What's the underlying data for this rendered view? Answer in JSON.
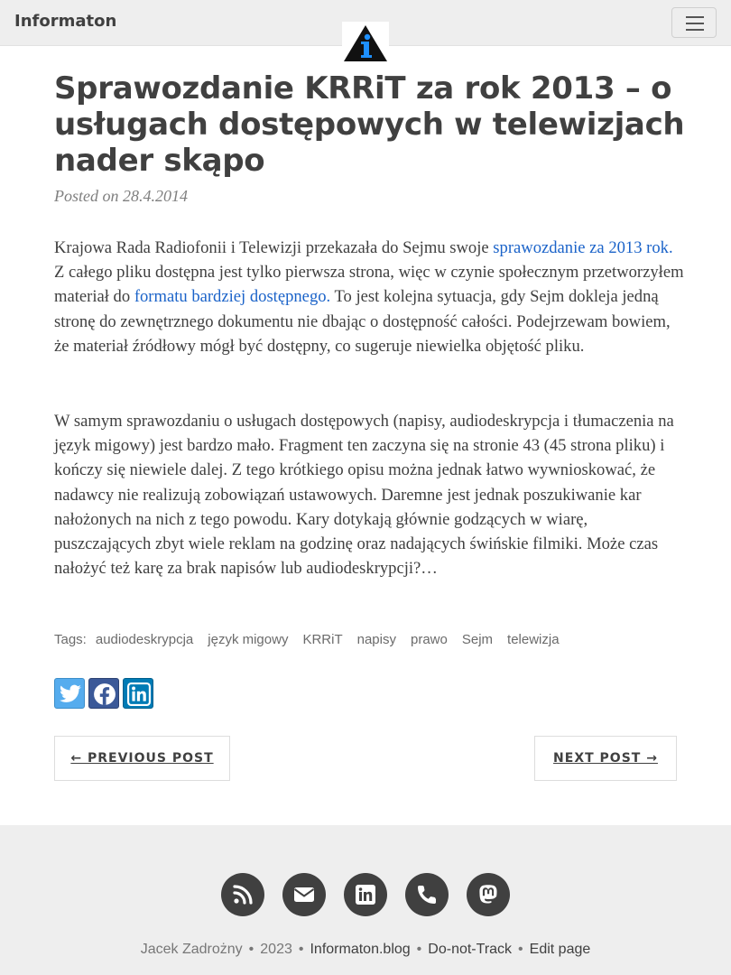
{
  "navbar": {
    "brand": "Informaton",
    "logo_icon": "info-triangle-logo",
    "menu_icon": "hamburger-icon"
  },
  "post": {
    "title": "Sprawozdanie KRRiT za rok 2013 – o usługach dostępowych w telewizjach nader skąpo",
    "meta": "Posted on 28.4.2014",
    "p1": {
      "t1": "Krajowa Rada Radiofonii i Telewizji przekazała do Sejmu swoje ",
      "link1": "sprawozdanie za 2013 rok.",
      "t2": " Z całego pliku dostępna jest tylko pierwsza strona, więc w czynie społecznym przetworzyłem materiał do ",
      "link2": "formatu bardziej dostępnego.",
      "t3": " To jest kolejna sytuacja, gdy Sejm dokleja jedną stronę do zewnętrznego dokumentu nie dbając o dostępność całości. Podejrzewam bowiem, że materiał źródłowy mógł być dostępny, co sugeruje niewielka objętość pliku."
    },
    "p2": "W samym sprawozdaniu o usługach dostępowych (napisy, audiodeskrypcja i tłumaczenia na język migowy) jest bardzo mało. Fragment ten zaczyna się na stronie 43 (45 strona pliku) i kończy się niewiele dalej. Z tego krótkiego opisu można jednak łatwo wywnioskować, że nadawcy nie realizują zobowiązań ustawowych. Daremne jest jednak poszukiwanie kar nałożonych na nich z tego powodu. Kary dotykają głównie godzących w wiarę, puszczających zbyt wiele reklam na godzinę oraz nadających świńskie filmiki. Może czas nałożyć też karę za brak napisów lub audiodeskrypcji?…",
    "tags_label": "Tags:",
    "tags": [
      "audiodeskrypcja",
      "język migowy",
      "KRRiT",
      "napisy",
      "prawo",
      "Sejm",
      "telewizja"
    ]
  },
  "share": {
    "icons": [
      "twitter-icon",
      "facebook-icon",
      "linkedin-icon"
    ],
    "colors": {
      "twitter": "#55acee",
      "facebook": "#3b5998",
      "linkedin": "#007bb5"
    }
  },
  "pager": {
    "previous": "← PREVIOUS POST",
    "next": "NEXT POST →"
  },
  "footer": {
    "social_icons": [
      "rss-icon",
      "envelope-icon",
      "linkedin-icon",
      "phone-icon",
      "mastodon-icon"
    ],
    "author": "Jacek Zadrożny",
    "sep": "•",
    "year": "2023",
    "site": "Informaton.blog",
    "dnt": "Do-not-Track",
    "edit": "Edit page"
  },
  "colors": {
    "navbar_bg": "#eeeeee",
    "text": "#404040",
    "link": "#1b63c9",
    "logo_blue": "#1e90ff"
  }
}
